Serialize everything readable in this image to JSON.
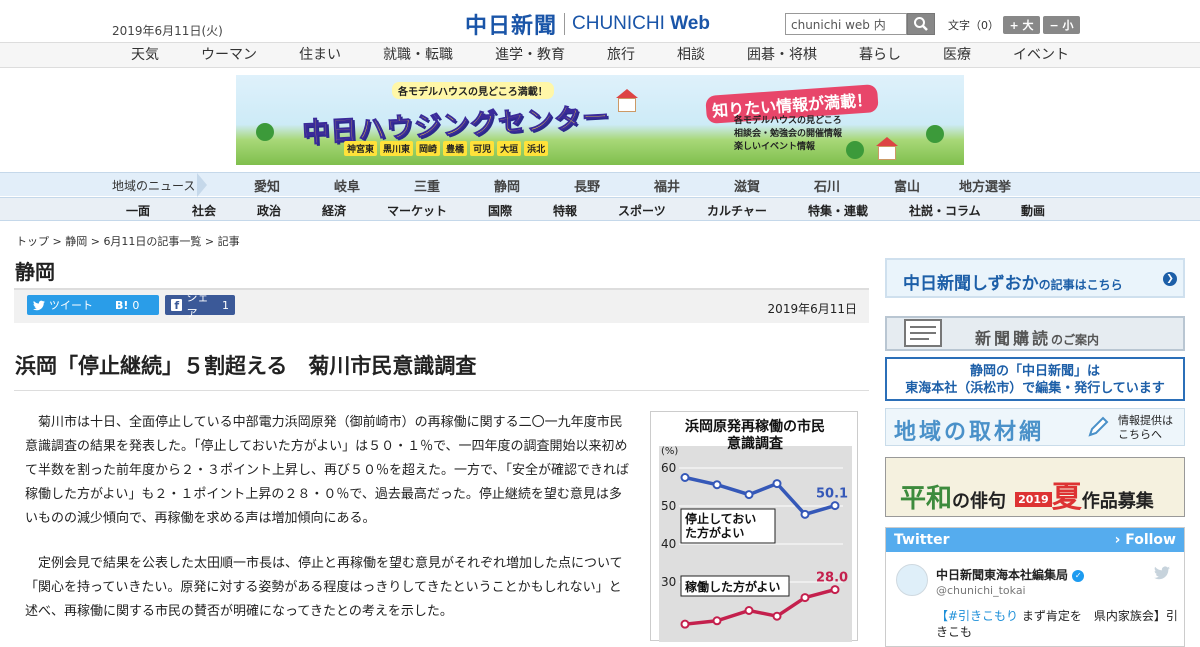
{
  "header": {
    "date": "2019年6月11日(火)",
    "logo_jp": "中日新聞",
    "logo_en_prefix": "CHUNICHI",
    "logo_en_suffix": "Web",
    "search_placeholder": "chunichi web 内",
    "font_size_label": "文字（0）",
    "font_bigger": "+ 大",
    "font_smaller": "− 小"
  },
  "category_nav": [
    "天気",
    "ウーマン",
    "住まい",
    "就職・転職",
    "進学・教育",
    "旅行",
    "相談",
    "囲碁・将棋",
    "暮らし",
    "医療",
    "イベント"
  ],
  "banner": {
    "small": "各モデルハウスの見どころ満載！",
    "title": "中日ハウジングセンター",
    "tags": [
      "神宮東",
      "黒川東",
      "岡崎",
      "豊橋",
      "可児",
      "大垣",
      "浜北"
    ],
    "right_title": "知りたい情報が満載！",
    "list": [
      "各モデルハウスの見どころ",
      "相談会・勉強会の開催情報",
      "楽しいイベント情報"
    ]
  },
  "region_nav": {
    "label": "地域のニュース",
    "items": [
      "愛知",
      "岐阜",
      "三重",
      "静岡",
      "長野",
      "福井",
      "滋賀",
      "石川",
      "富山",
      "地方選挙"
    ]
  },
  "section_nav": [
    "一面",
    "社会",
    "政治",
    "経済",
    "マーケット",
    "国際",
    "特報",
    "スポーツ",
    "カルチャー",
    "特集・連載",
    "社説・コラム",
    "動画"
  ],
  "breadcrumb": {
    "items": [
      "トップ",
      "静岡",
      "6月11日の記事一覧"
    ],
    "current": "記事",
    "sep": " > "
  },
  "article": {
    "prefecture": "静岡",
    "share": {
      "tweet": "ツイート",
      "hatena_count": "0",
      "fb_label": "シェア",
      "fb_count": "1"
    },
    "date": "2019年6月11日",
    "headline": "浜岡「停止継続」５割超える　菊川市民意識調査",
    "paragraphs": [
      "菊川市は十日、全面停止している中部電力浜岡原発（御前崎市）の再稼働に関する二〇一九年度市民意識調査の結果を発表した。「停止しておいた方がよい」は５０・１％で、一四年度の調査開始以来初めて半数を割った前年度から２・３ポイント上昇し、再び５０％を超えた。一方で、「安全が確認できれば稼働した方がよい」も２・１ポイント上昇の２８・０％で、過去最高だった。停止継続を望む意見は多いものの減少傾向で、再稼働を求める声は増加傾向にある。",
      "定例会見で結果を公表した太田順一市長は、停止と再稼働を望む意見がそれぞれ増加した点について「関心を持っていきたい。原発に対する姿勢がある程度はっきりしてきたということかもしれない」と述べ、再稼働に関する市民の賛否が明確になってきたとの考えを示した。"
    ]
  },
  "chart_data": {
    "type": "line",
    "title": "浜岡原発再稼働の市民意識調査",
    "ylabel": "(%)",
    "y_ticks": [
      60,
      50,
      40,
      30
    ],
    "series": [
      {
        "name": "停止しておいた方がよい",
        "color": "#3558b8",
        "values": [
          57.5,
          55.6,
          53.0,
          55.9,
          47.8,
          50.1
        ],
        "end_label": "50.1"
      },
      {
        "name": "稼働した方がよい",
        "color": "#c4204d",
        "values": [
          18.9,
          19.8,
          22.5,
          21.0,
          25.9,
          28.0
        ],
        "end_label": "28.0"
      }
    ]
  },
  "sidebar": {
    "shizuoka_title": "中日新聞しずおか",
    "shizuoka_suffix": "の記事はこちら",
    "subscribe_title": "新聞購読",
    "subscribe_suffix": "のご案内",
    "tokai_line1": "静岡の「中日新聞」は",
    "tokai_line2": "東海本社（浜松市）で編集・発行しています",
    "chiiki_title": "地域の取材網",
    "chiiki_side1": "情報提供は",
    "chiiki_side2": "こちらへ",
    "haiku_a": "平和",
    "haiku_b": "の俳句",
    "haiku_year": "2019",
    "haiku_season": "夏",
    "haiku_c": "作品募集",
    "twitter_label": "Twitter",
    "follow_label": "› Follow",
    "tw_name": "中日新聞東海本社編集局",
    "tw_handle": "@chunichi_tokai",
    "tw_tag": "【#引きこもり",
    "tw_text": " まず肯定を　県内家族会】引きこも"
  },
  "colors": {
    "brand": "#1a55a8",
    "twitter": "#55acee",
    "stop_series": "#3558b8",
    "restart_series": "#c4204d"
  }
}
